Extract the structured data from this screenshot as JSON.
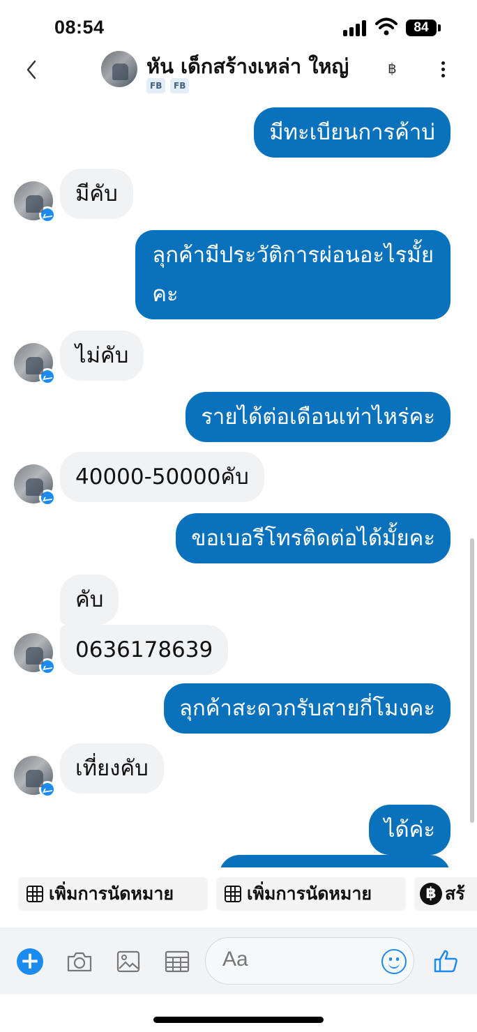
{
  "status_bar": {
    "time": "08:54",
    "battery": "84"
  },
  "header": {
    "contact_name": "หัน เด็กสร้างเหล่า ใหญ่",
    "tags": [
      "FB",
      "FB"
    ],
    "baht_symbol": "฿"
  },
  "messages": [
    {
      "side": "out",
      "text": "มีทะเบียนการค้าบ่"
    },
    {
      "side": "in",
      "text": "มีคับ"
    },
    {
      "side": "out",
      "line1": "ลุกค้ามีประวัติการผ่อนอะไรมั้ย",
      "line2": "คะ"
    },
    {
      "side": "in",
      "text": "ไม่คับ"
    },
    {
      "side": "out",
      "text": "รายได้ต่อเดือนเท่าไหร่คะ"
    },
    {
      "side": "in",
      "text": "40000-50000คับ"
    },
    {
      "side": "out",
      "text": "ขอเบอรีโทรติดต่อได้มั้ยคะ"
    },
    {
      "side": "in",
      "text": "คับ"
    },
    {
      "side": "in",
      "text": "0636178639"
    },
    {
      "side": "out",
      "text": "ลุกค้าสะดวกรับสายกี่โมงคะ"
    },
    {
      "side": "in",
      "text": "เที่ยงคับ"
    },
    {
      "side": "out",
      "text": "ได้ค่ะ"
    }
  ],
  "quick_actions": [
    {
      "label": "เพิ่มการนัดหมาย",
      "icon": "calendar-grid-icon"
    },
    {
      "label": "เพิ่มการนัดหมาย",
      "icon": "calendar-grid-icon"
    },
    {
      "label": "สร้",
      "icon": "baht-coin-icon"
    }
  ],
  "composer": {
    "placeholder": "Aa"
  },
  "colors": {
    "outgoing": "#0a72bc",
    "incoming": "#f1f2f4",
    "accent": "#1b8bf0"
  }
}
